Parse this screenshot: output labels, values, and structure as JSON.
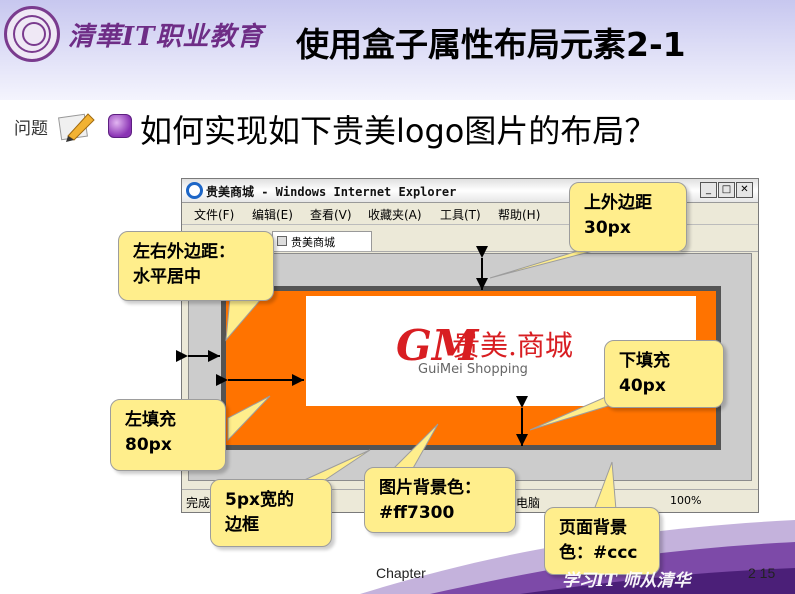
{
  "header": {
    "school_name": "清華IT职业教育",
    "slide_title": "使用盒子属性布局元素2-1"
  },
  "question": {
    "icon_label": "问题",
    "text": "如何实现如下贵美logo图片的布局？"
  },
  "browser": {
    "window_title": "贵美商城 - Windows Internet Explorer",
    "menu": [
      "文件(F)",
      "编辑(E)",
      "查看(V)",
      "收藏夹(A)",
      "工具(T)",
      "帮助(H)"
    ],
    "tab_label": "贵美商城",
    "status_text": "完成",
    "status_zone": "电脑",
    "zoom": "100%",
    "logo": {
      "mark": "GM",
      "cn": "贵美.商城",
      "en": "GuiMei Shopping"
    }
  },
  "callouts": {
    "top_margin": "上外边距\n30px",
    "lr_margin": "左右外边距：\n水平居中",
    "left_padding": "左填充\n80px",
    "bottom_padding": "下填充\n40px",
    "border": "5px宽的\n边框",
    "img_bg": "图片背景色：\n#ff7300",
    "page_bg": "页面背景\n色：#ccc"
  },
  "footer": {
    "chapter": "Chapter",
    "page": "2  15",
    "calligraphy": "学习IT 师从清华"
  },
  "colors": {
    "orange": "#ff7300",
    "page_bg": "#cccccc",
    "callout_bg": "#ffee8c",
    "purple": "#6e2d86"
  }
}
